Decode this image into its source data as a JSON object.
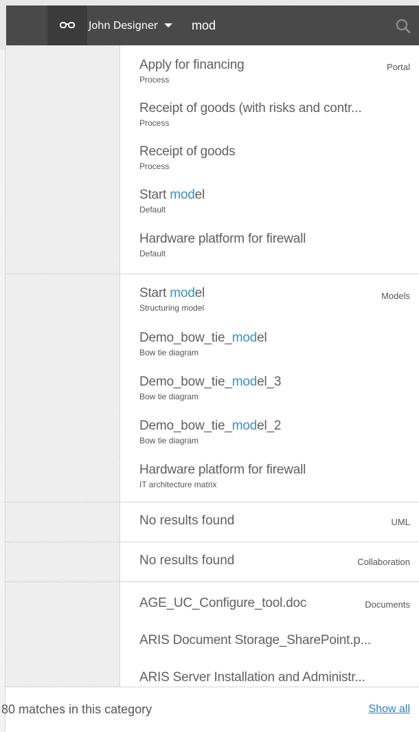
{
  "header": {
    "user_name": "John Designer",
    "search_query": "mod",
    "colors": {
      "bar": "#494949",
      "highlight": "#3b8fc4",
      "link": "#2f7fc1"
    }
  },
  "sections": [
    {
      "category": "Portal",
      "items": [
        {
          "pre": "Apply for financing",
          "hl": "",
          "post": "",
          "type": "Process"
        },
        {
          "pre": "Receipt of goods (with risks and contr...",
          "hl": "",
          "post": "",
          "type": "Process"
        },
        {
          "pre": "Receipt of goods",
          "hl": "",
          "post": "",
          "type": "Process"
        },
        {
          "pre": "Start ",
          "hl": "mod",
          "post": "el",
          "type": "Default"
        },
        {
          "pre": "Hardware platform for firewall",
          "hl": "",
          "post": "",
          "type": "Default"
        }
      ]
    },
    {
      "category": "Models",
      "items": [
        {
          "pre": "Start ",
          "hl": "mod",
          "post": "el",
          "type": "Structuring model"
        },
        {
          "pre": "Demo_bow_tie_",
          "hl": "mod",
          "post": "el",
          "type": "Bow tie diagram"
        },
        {
          "pre": "Demo_bow_tie_",
          "hl": "mod",
          "post": "el_3",
          "type": "Bow tie diagram"
        },
        {
          "pre": "Demo_bow_tie_",
          "hl": "mod",
          "post": "el_2",
          "type": "Bow tie diagram"
        },
        {
          "pre": "Hardware platform for firewall",
          "hl": "",
          "post": "",
          "type": "IT architecture matrix"
        }
      ]
    },
    {
      "category": "UML",
      "no_results": "No results found"
    },
    {
      "category": "Collaboration",
      "no_results": "No results found"
    },
    {
      "category": "Documents",
      "items": [
        {
          "pre": "AGE_UC_Configure_tool.doc",
          "hl": "",
          "post": "",
          "type": ""
        },
        {
          "pre": "ARIS Document Storage_SharePoint.p...",
          "hl": "",
          "post": "",
          "type": ""
        },
        {
          "pre": "ARIS Server Installation and Administr...",
          "hl": "",
          "post": "",
          "type": ""
        }
      ]
    }
  ],
  "footer": {
    "matches": "80 matches in this category",
    "show_all": "Show all"
  }
}
